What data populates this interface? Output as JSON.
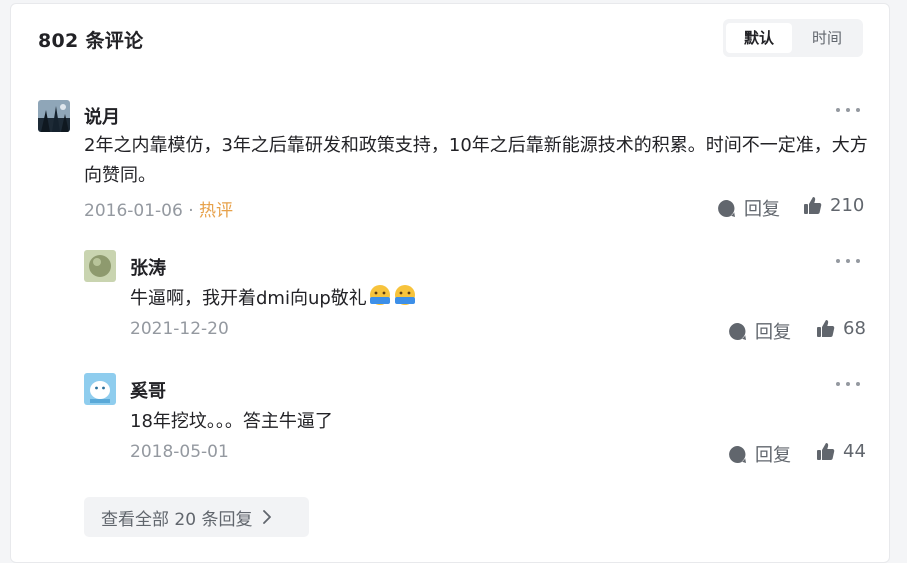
{
  "header": {
    "title": "802 条评论",
    "sort_default": "默认",
    "sort_time": "时间"
  },
  "comments": [
    {
      "user": "说月",
      "text": "2年之内靠模仿，3年之后靠研发和政策支持，10年之后靠新能源技术的积累。时间不一定准，大方向赞同。",
      "date": "2016-01-06",
      "separator": "·",
      "tag": "热评",
      "reply_label": "回复",
      "likes": "210"
    }
  ],
  "replies": [
    {
      "user": "张涛",
      "text": "牛逼啊，我开着dmi向up敬礼",
      "emoji_label": "赞同",
      "date": "2021-12-20",
      "reply_label": "回复",
      "likes": "68"
    },
    {
      "user": "奚哥",
      "text": "18年挖坟。。。答主牛逼了",
      "date": "2018-05-01",
      "reply_label": "回复",
      "likes": "44"
    }
  ],
  "view_all": {
    "label": "查看全部 20 条回复"
  },
  "colors": {
    "text_primary": "#222226",
    "text_secondary": "#9499a0",
    "hot_tag": "#e7a14a",
    "icon_gray": "#61666d"
  }
}
